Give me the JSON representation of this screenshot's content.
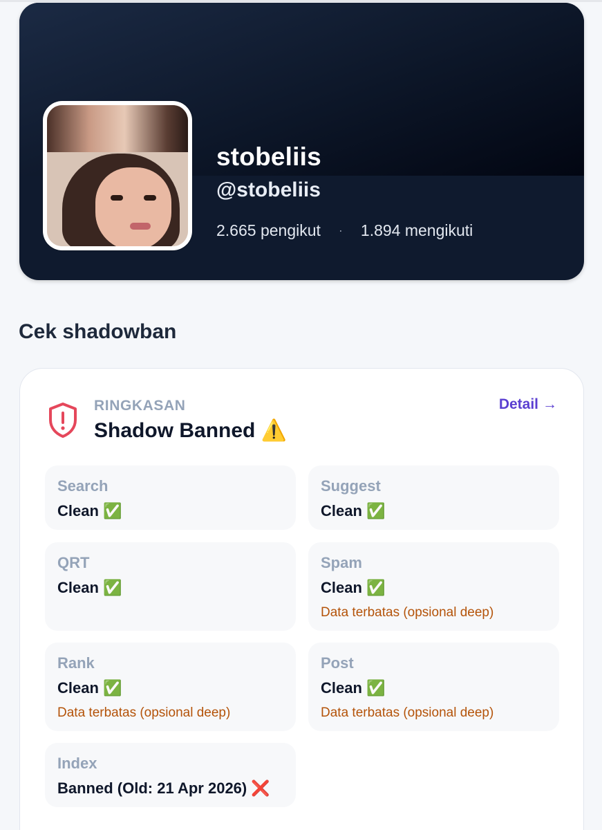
{
  "profile": {
    "display_name": "stobeliis",
    "handle": "@stobeliis",
    "followers": "2.665 pengikut",
    "separator": "·",
    "following": "1.894 mengikuti"
  },
  "section_title": "Cek shadowban",
  "summary": {
    "label": "RINGKASAN",
    "status": "Shadow Banned ⚠️",
    "detail_link": "Detail",
    "detail_arrow": "→",
    "shield_color": "#e5475b"
  },
  "checks": {
    "search": {
      "label": "Search",
      "value": "Clean ✅"
    },
    "suggest": {
      "label": "Suggest",
      "value": "Clean ✅"
    },
    "qrt": {
      "label": "QRT",
      "value": "Clean ✅"
    },
    "spam": {
      "label": "Spam",
      "value": "Clean ✅",
      "note": "Data terbatas (opsional deep)"
    },
    "rank": {
      "label": "Rank",
      "value": "Clean ✅",
      "note": "Data terbatas (opsional deep)"
    },
    "post": {
      "label": "Post",
      "value": "Clean ✅",
      "note": "Data terbatas (opsional deep)"
    },
    "index": {
      "label": "Index",
      "value": "Banned (Old: 21 Apr 2026) ❌"
    }
  }
}
